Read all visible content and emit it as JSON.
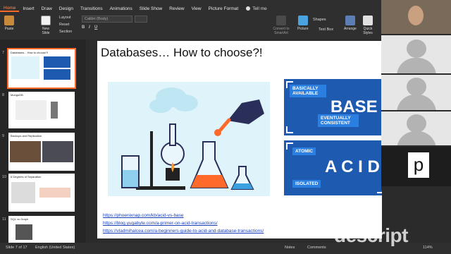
{
  "ribbon": {
    "tabs": [
      "Home",
      "Insert",
      "Draw",
      "Design",
      "Transitions",
      "Animations",
      "Slide Show",
      "Review",
      "View",
      "Picture Format"
    ],
    "active_tab": "Home",
    "tell_me": "Tell me",
    "paste": "Paste",
    "new_slide": "New Slide",
    "layout": "Layout",
    "reset": "Reset",
    "section": "Section",
    "font_name": "Calibri (Body)",
    "convert_to_smartart": "Convert to SmartArt",
    "picture": "Picture",
    "text_box": "Text Box",
    "shapes": "Shapes",
    "arrange": "Arrange",
    "quick_styles": "Quick Styles"
  },
  "thumbnails": [
    {
      "num": "7",
      "title": "Databases... How to choose?!",
      "selected": true
    },
    {
      "num": "8",
      "title": "MongoDB",
      "selected": false
    },
    {
      "num": "9",
      "title": "Backups and Replication",
      "selected": false
    },
    {
      "num": "10",
      "title": "6 Degrees of Separation",
      "selected": false
    },
    {
      "num": "11",
      "title": "SQL vs Graph",
      "selected": false
    }
  ],
  "slide": {
    "title": "Databases… How to choose?!",
    "base": {
      "label1": "BASICALLY AVAILABLE",
      "word": "BASE",
      "label2": "EVENTUALLY CONSISTENT"
    },
    "acid": {
      "label1": "ATOMIC",
      "word": "A C I D",
      "label2": "ISOLATED"
    },
    "links": [
      "https://phoenixnap.com/kb/acid-vs-base",
      "https://blog.yugabyte.com/a-primer-on-acid-transactions/",
      "https://vladmihalcea.com/a-beginners-guide-to-acid-and-database-transactions/"
    ]
  },
  "video": {
    "letter": "p"
  },
  "status": {
    "slide_counter": "Slide 7 of 17",
    "language": "English (United States)",
    "notes": "Notes",
    "comments": "Comments",
    "zoom": "114%"
  },
  "watermark": "descript",
  "colors": {
    "accent": "#ff6a2b",
    "block_blue": "#1e5bb0",
    "pill_blue": "#2a7fe0",
    "link": "#1a3fb8"
  }
}
